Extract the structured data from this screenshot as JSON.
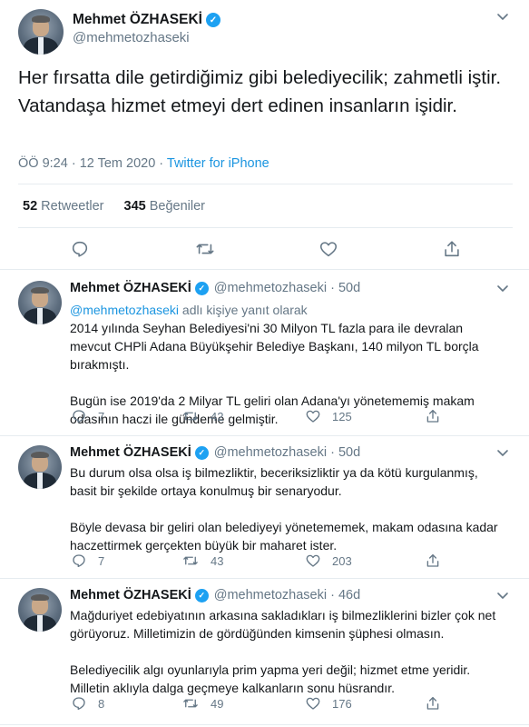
{
  "main_tweet": {
    "author_name": "Mehmet ÖZHASEKİ",
    "handle": "@mehmetozhaseki",
    "text": "Her fırsatta dile getirdiğimiz gibi belediyecilik; zahmetli iştir. Vatandaşa hizmet etmeyi dert edinen insanların işidir.",
    "time_date": "ÖÖ 9:24 · 12 Tem 2020 · ",
    "client": "Twitter for iPhone",
    "retweets_count": "52",
    "retweets_label": "Retweetler",
    "likes_count": "345",
    "likes_label": "Beğeniler",
    "icons": [
      "reply-icon",
      "retweet-icon",
      "like-icon",
      "share-icon"
    ]
  },
  "replies": [
    {
      "author_name": "Mehmet ÖZHASEKİ",
      "handle_age": "@mehmetozhaseki · 50d",
      "reply_to_handle": "@mehmetozhaseki",
      "reply_to_suffix": " adlı kişiye yanıt olarak",
      "paragraphs": [
        "2014 yılında Seyhan Belediyesi'ni 30 Milyon TL fazla para ile devralan mevcut CHPli Adana Büyükşehir Belediye Başkanı, 140 milyon TL borçla bırakmıştı.",
        "Bugün ise 2019'da 2 Milyar TL geliri olan Adana'yı yönetememiş makam odasının haczi ile gündeme gelmiştir."
      ],
      "replies": "7",
      "retweets": "42",
      "likes": "125"
    },
    {
      "author_name": "Mehmet ÖZHASEKİ",
      "handle_age": "@mehmetozhaseki · 50d",
      "paragraphs": [
        "Bu durum olsa olsa iş bilmezliktir, beceriksizliktir ya da kötü kurgulanmış, basit bir şekilde ortaya konulmuş bir senaryodur.",
        "Böyle devasa bir geliri olan belediyeyi yönetememek, makam odasına kadar haczettirmek gerçekten büyük bir maharet ister."
      ],
      "replies": "7",
      "retweets": "43",
      "likes": "203"
    },
    {
      "author_name": "Mehmet ÖZHASEKİ",
      "handle_age": "@mehmetozhaseki · 46d",
      "paragraphs": [
        "Mağduriyet edebiyatının arkasına sakladıkları iş bilmezliklerini bizler çok net görüyoruz. Milletimizin de gördüğünden kimsenin şüphesi olmasın.",
        "Belediyecilik algı oyunlarıyla prim yapma yeri değil; hizmet etme yeridir. Milletin aklıyla dalga geçmeye kalkanların sonu hüsrandır."
      ],
      "replies": "8",
      "retweets": "49",
      "likes": "176"
    }
  ],
  "colors": {
    "accent": "#1da1f2",
    "link": "#1b95e0",
    "muted": "#657786",
    "text": "#14171a",
    "divider": "#e6ecf0"
  }
}
